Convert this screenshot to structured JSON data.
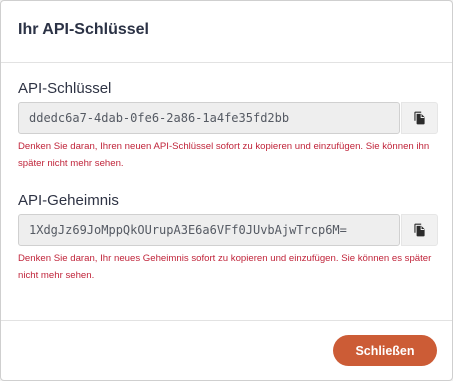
{
  "dialog": {
    "title": "Ihr API-Schlüssel",
    "close_label": "Schließen"
  },
  "api_key": {
    "label": "API-Schlüssel",
    "value": "ddedc6a7-4dab-0fe6-2a86-1a4fe35fd2bb",
    "warning": "Denken Sie daran, Ihren neuen API-Schlüssel sofort zu kopieren und einzufügen. Sie können ihn später nicht mehr sehen.",
    "copy_icon": "copy-icon"
  },
  "api_secret": {
    "label": "API-Geheimnis",
    "value": "1XdgJz69JoMppQkOUrupA3E6a6VFf0JUvbAjwTrcp6M=",
    "warning": "Denken Sie daran, Ihr neues Geheimnis sofort zu kopieren und einzufügen. Sie können es später nicht mehr sehen.",
    "copy_icon": "copy-icon"
  },
  "colors": {
    "title": "#2b3245",
    "warning": "#c0243a",
    "primary_button": "#cc5c36",
    "input_background": "#eeeeee"
  }
}
